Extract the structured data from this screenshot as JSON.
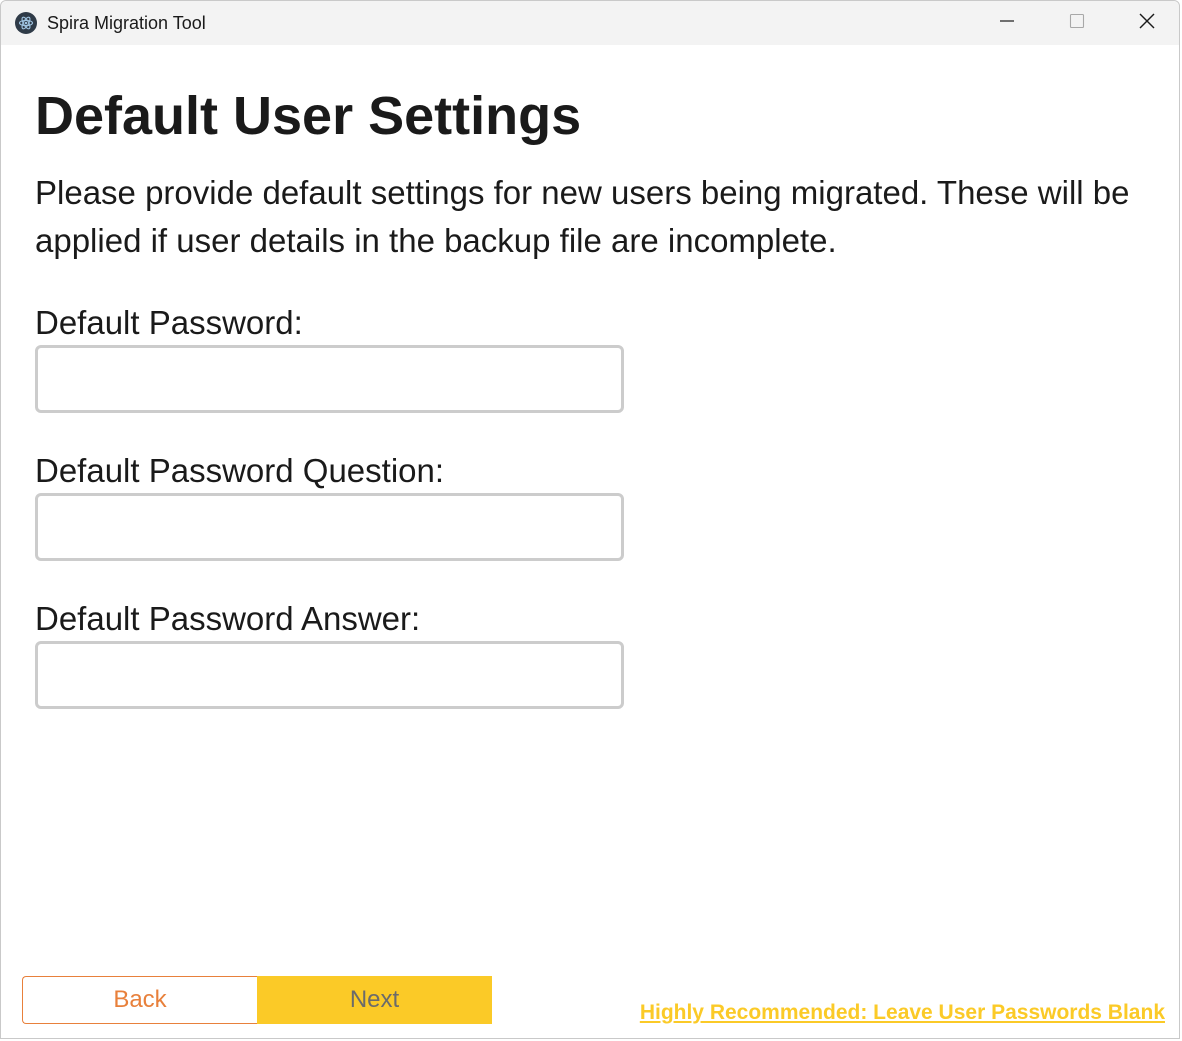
{
  "window": {
    "title": "Spira Migration Tool",
    "controls": {
      "minimize_icon": "minimize-icon",
      "maximize_icon": "maximize-icon",
      "close_icon": "close-icon"
    }
  },
  "page": {
    "title": "Default User Settings",
    "description": "Please provide default settings for new users being migrated. These will be applied if user details in the backup file are incomplete."
  },
  "form": {
    "password": {
      "label": "Default Password:",
      "value": "",
      "placeholder": ""
    },
    "question": {
      "label": "Default Password Question:",
      "value": "",
      "placeholder": ""
    },
    "answer": {
      "label": "Default Password Answer:",
      "value": "",
      "placeholder": ""
    }
  },
  "footer": {
    "back_label": "Back",
    "next_label": "Next",
    "recommend_link": "Highly Recommended: Leave User Passwords Blank"
  },
  "colors": {
    "accent_yellow": "#fbca27",
    "accent_orange": "#e8803b",
    "input_border": "#cccccc",
    "titlebar": "#f3f3f3"
  }
}
